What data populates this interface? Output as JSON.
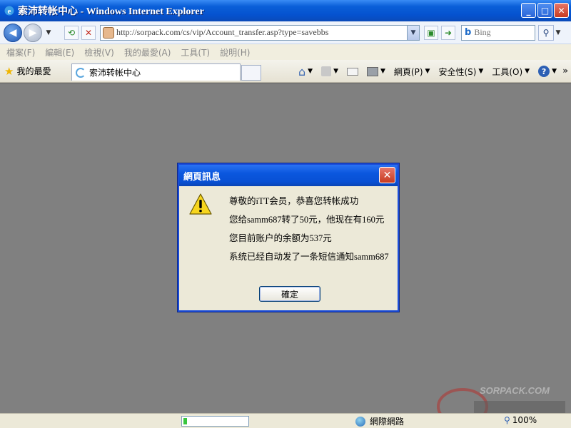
{
  "window": {
    "title": "索沛转帐中心 - Windows Internet Explorer",
    "buttons": {
      "minimize": "_",
      "maximize": "□",
      "close": "✕"
    }
  },
  "address_bar": {
    "url": "http://sorpack.com/cs/vip/Account_transfer.asp?type=savebbs",
    "search_placeholder": "Bing",
    "search_provider": "b"
  },
  "menu": {
    "items": [
      "檔案(F)",
      "編輯(E)",
      "檢視(V)",
      "我的最愛(A)",
      "工具(T)",
      "說明(H)"
    ]
  },
  "toolbar": {
    "favorites_label": "我的最愛",
    "tab_title": "索沛转帐中心",
    "page_label": "網頁(P)",
    "safety_label": "安全性(S)",
    "tools_label": "工具(O)",
    "chevron": "»"
  },
  "dialog": {
    "title": "網頁訊息",
    "messages": [
      "尊敬的iTT会员，恭喜您转帐成功",
      "您给samm687转了50元，他现在有160元",
      "您目前账户的余额为537元",
      "系统已经自动发了一条短信通知samm687"
    ],
    "ok_label": "確定",
    "close_glyph": "✕"
  },
  "statusbar": {
    "progress": 0.06,
    "zone_label": "網際網路",
    "zoom_label": "100%"
  },
  "colors": {
    "titlebar": "#0a5fd8",
    "content_bg": "#808080",
    "dialog_bg": "#ece9d8",
    "close_red": "#c73a20"
  },
  "watermark": {
    "text": "SORPACK.COM"
  }
}
